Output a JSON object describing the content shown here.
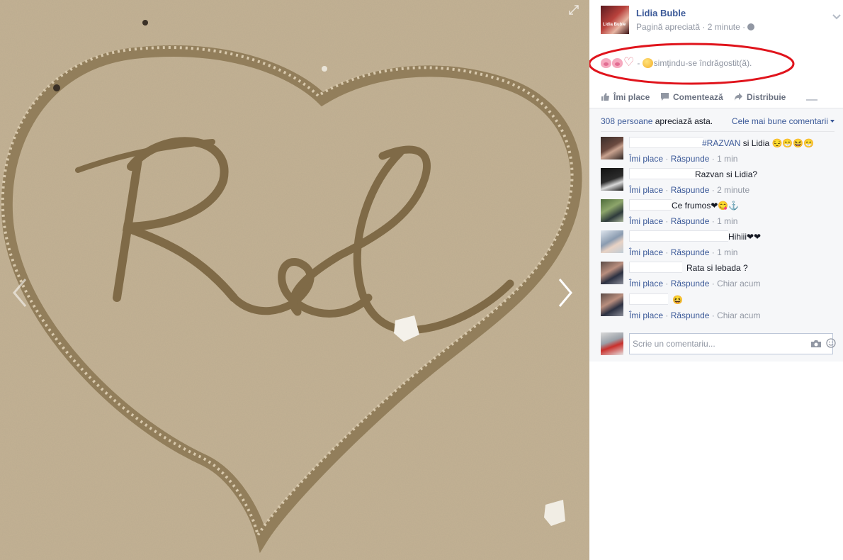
{
  "post": {
    "page_name": "Lidia Buble",
    "meta": "Pagină apreciată · 2 minute ·",
    "avatar_text": "Lidia Buble",
    "status_separator": " - ",
    "feeling": "simţindu-se îndrăgostit(ă)."
  },
  "actions": {
    "like": "Îmi place",
    "comment": "Comentează",
    "share": "Distribuie"
  },
  "likes": {
    "count": "308 persoane",
    "text": " apreciază asta.",
    "sort": "Cele mai bune comentarii"
  },
  "comment_actions": {
    "like": "Îmi place",
    "reply": "Răspunde"
  },
  "comments": [
    {
      "tag": "#RAZVAN",
      "text": " si Lidia 😔😁😆😁",
      "time": "1 min"
    },
    {
      "tag": "",
      "text": "Razvan si Lidia?",
      "time": "2 minute"
    },
    {
      "tag": "",
      "text": "Ce frumos❤😋⚓",
      "time": "1 min"
    },
    {
      "tag": "",
      "text": "Hihiii❤❤",
      "time": "1 min"
    },
    {
      "tag": "",
      "text": "Rata si lebada ?",
      "time": "Chiar acum"
    },
    {
      "tag": "",
      "text": "😆",
      "time": "Chiar acum"
    }
  ],
  "composer": {
    "placeholder": "Scrie un comentariu..."
  },
  "icons": {
    "prev": "chevron-left-icon",
    "next": "chevron-right-icon",
    "expand": "expand-icon",
    "privacy": "globe-icon",
    "like": "thumbs-up-icon",
    "comment": "speech-bubble-icon",
    "share": "share-arrow-icon",
    "camera": "camera-icon",
    "emoji": "smiley-icon"
  },
  "colors": {
    "link": "#3b5998",
    "muted": "#9197a3",
    "highlight": "#e0141c"
  }
}
